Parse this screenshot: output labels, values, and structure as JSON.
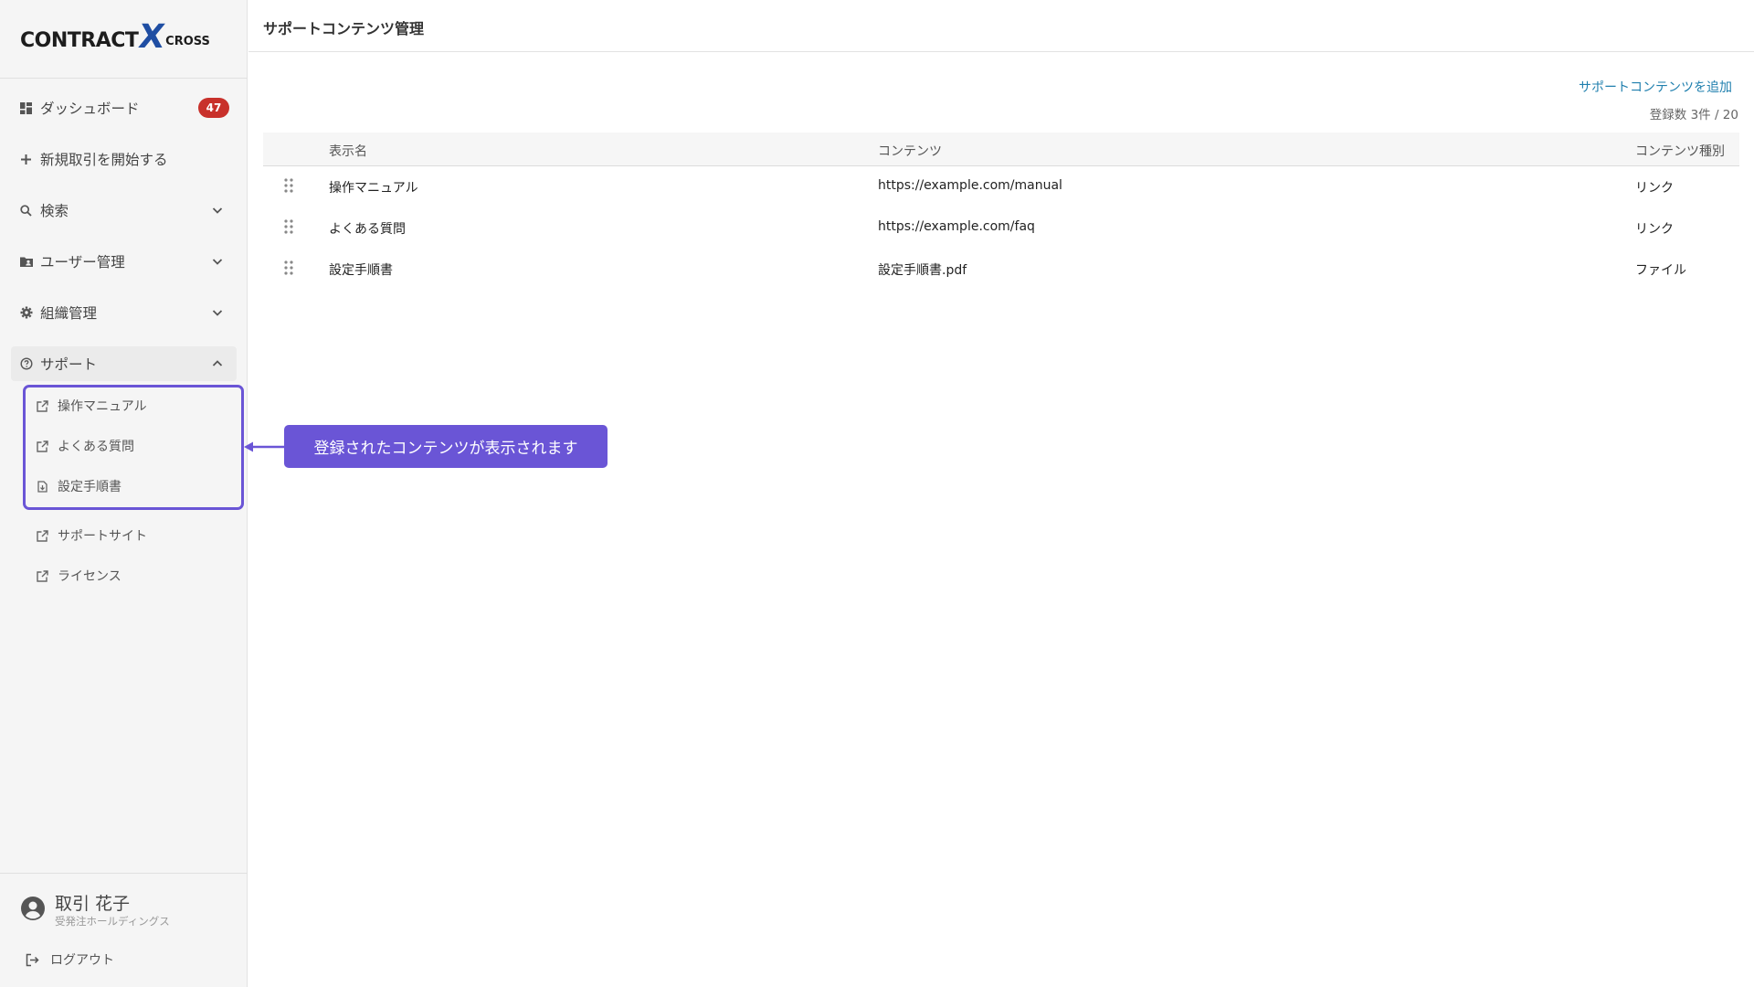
{
  "app": {
    "logo": {
      "main": "CONTRACT",
      "x": "X",
      "cross": "CROSS"
    }
  },
  "sidebar": {
    "items": [
      {
        "label": "ダッシュボード",
        "icon": "dashboard-icon",
        "badge": "47"
      },
      {
        "label": "新規取引を開始する",
        "icon": "plus-icon"
      },
      {
        "label": "検索",
        "icon": "search-icon"
      },
      {
        "label": "ユーザー管理",
        "icon": "folder-user-icon"
      },
      {
        "label": "組織管理",
        "icon": "gear-icon"
      },
      {
        "label": "サポート",
        "icon": "help-circle-icon"
      }
    ],
    "support_sub": [
      {
        "label": "操作マニュアル",
        "icon": "external-link-icon"
      },
      {
        "label": "よくある質問",
        "icon": "external-link-icon"
      },
      {
        "label": "設定手順書",
        "icon": "file-download-icon"
      },
      {
        "label": "サポートサイト",
        "icon": "external-link-icon"
      },
      {
        "label": "ライセンス",
        "icon": "external-link-icon"
      }
    ],
    "user": {
      "name": "取引 花子",
      "org": "受発注ホールディングス"
    },
    "logout_label": "ログアウト"
  },
  "main": {
    "title": "サポートコンテンツ管理",
    "add_link": "サポートコンテンツを追加",
    "count": "登録数 3件 / 20",
    "columns": [
      "表示名",
      "コンテンツ",
      "コンテンツ種別"
    ],
    "rows": [
      {
        "name": "操作マニュアル",
        "content": "https://example.com/manual",
        "type": "リンク"
      },
      {
        "name": "よくある質問",
        "content": "https://example.com/faq",
        "type": "リンク"
      },
      {
        "name": "設定手順書",
        "content": "設定手順書.pdf",
        "type": "ファイル"
      }
    ]
  },
  "callout": {
    "text": "登録されたコンテンツが表示されます"
  },
  "colors": {
    "accent": "#6a55d6",
    "link": "#1f7fae",
    "badge": "#c8312b",
    "logo_x": "#1f4ea3"
  }
}
